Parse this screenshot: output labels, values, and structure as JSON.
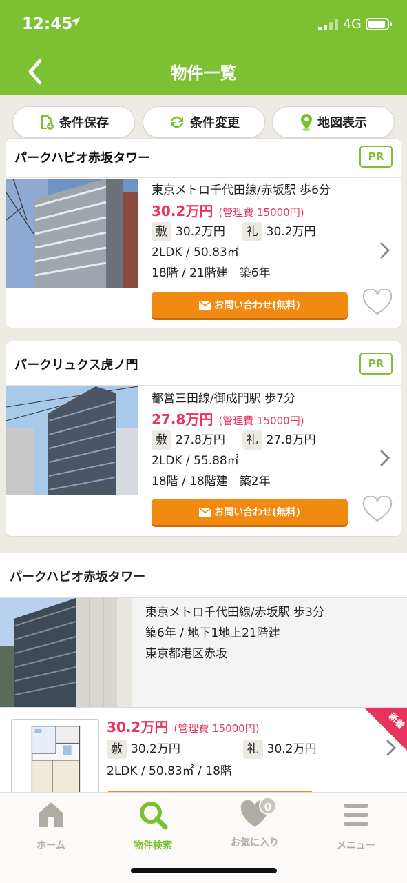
{
  "status": {
    "time": "12:45",
    "network": "4G"
  },
  "header": {
    "title": "物件一覧"
  },
  "toolbar": {
    "save_label": "条件保存",
    "change_label": "条件変更",
    "map_label": "地図表示"
  },
  "listings": [
    {
      "name": "パークハビオ赤坂タワー",
      "badge": "PR",
      "access": "東京メトロ千代田線/赤坂駅 歩6分",
      "price": "30.2万円",
      "fee": "(管理費 15000円)",
      "deposit_label": "敷",
      "deposit": "30.2万円",
      "key_money_label": "礼",
      "key_money": "30.2万円",
      "layout_area": "2LDK / 50.83㎡",
      "floor_age": "18階 / 21階建　築6年",
      "inquiry_label": "お問い合わせ(無料)"
    },
    {
      "name": "パークリュクス虎ノ門",
      "badge": "PR",
      "access": "都営三田線/御成門駅 歩7分",
      "price": "27.8万円",
      "fee": "(管理費 15000円)",
      "deposit_label": "敷",
      "deposit": "27.8万円",
      "key_money_label": "礼",
      "key_money": "27.8万円",
      "layout_area": "2LDK / 55.88㎡",
      "floor_age": "18階 / 18階建　築2年",
      "inquiry_label": "お問い合わせ(無料)"
    }
  ],
  "building": {
    "name": "パークハビオ赤坂タワー",
    "access": "東京メトロ千代田線/赤坂駅 歩3分",
    "age_floors": "築6年 / 地下1地上21階建",
    "address": "東京都港区赤坂",
    "room": {
      "price": "30.2万円",
      "fee": "(管理費 15000円)",
      "deposit_label": "敷",
      "deposit": "30.2万円",
      "key_money_label": "礼",
      "key_money": "30.2万円",
      "layout_area_floor": "2LDK / 50.83㎡ / 18階",
      "new_badge": "新着"
    }
  },
  "tabbar": {
    "home": "ホーム",
    "search": "物件検索",
    "favorites": "お気に入り",
    "favorites_count": "0",
    "menu": "メニュー"
  },
  "colors": {
    "brand": "#7cc132",
    "price": "#e8335d",
    "cta": "#f08a10",
    "new_badge": "#e8335d"
  }
}
